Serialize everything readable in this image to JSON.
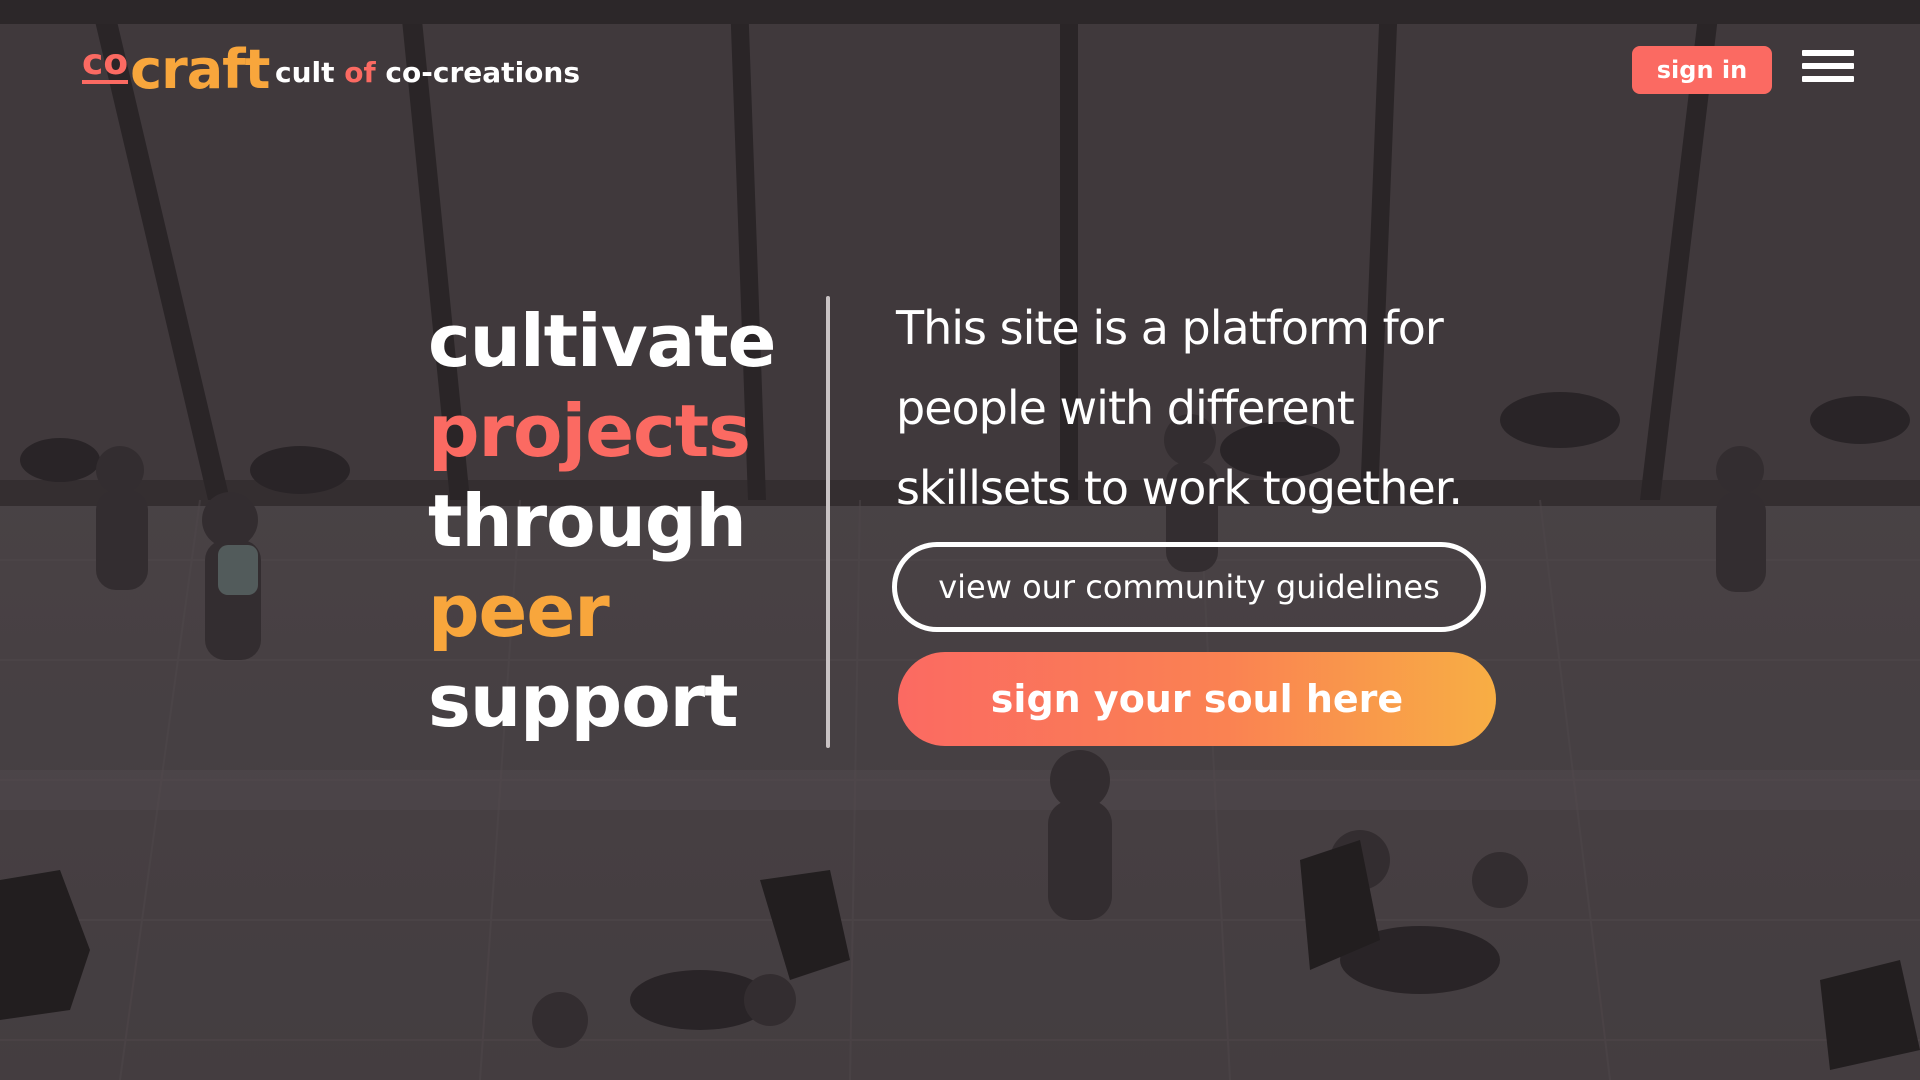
{
  "colors": {
    "coral": "#fb6a62",
    "orange": "#f8a63c",
    "white": "#ffffff"
  },
  "header": {
    "logo_co": "co",
    "logo_craft": "craft",
    "tagline_part1": "cult ",
    "tagline_accent": "of",
    "tagline_part2": " co-creations",
    "signin_label": "sign in",
    "menu_icon": "hamburger-menu-icon"
  },
  "hero": {
    "words": [
      "cultivate",
      "projects",
      "through",
      "peer",
      "support"
    ],
    "description": "This site is a platform for people with different skillsets to work together.",
    "guidelines_label": "view our community guidelines",
    "signup_label": "sign your soul here"
  }
}
